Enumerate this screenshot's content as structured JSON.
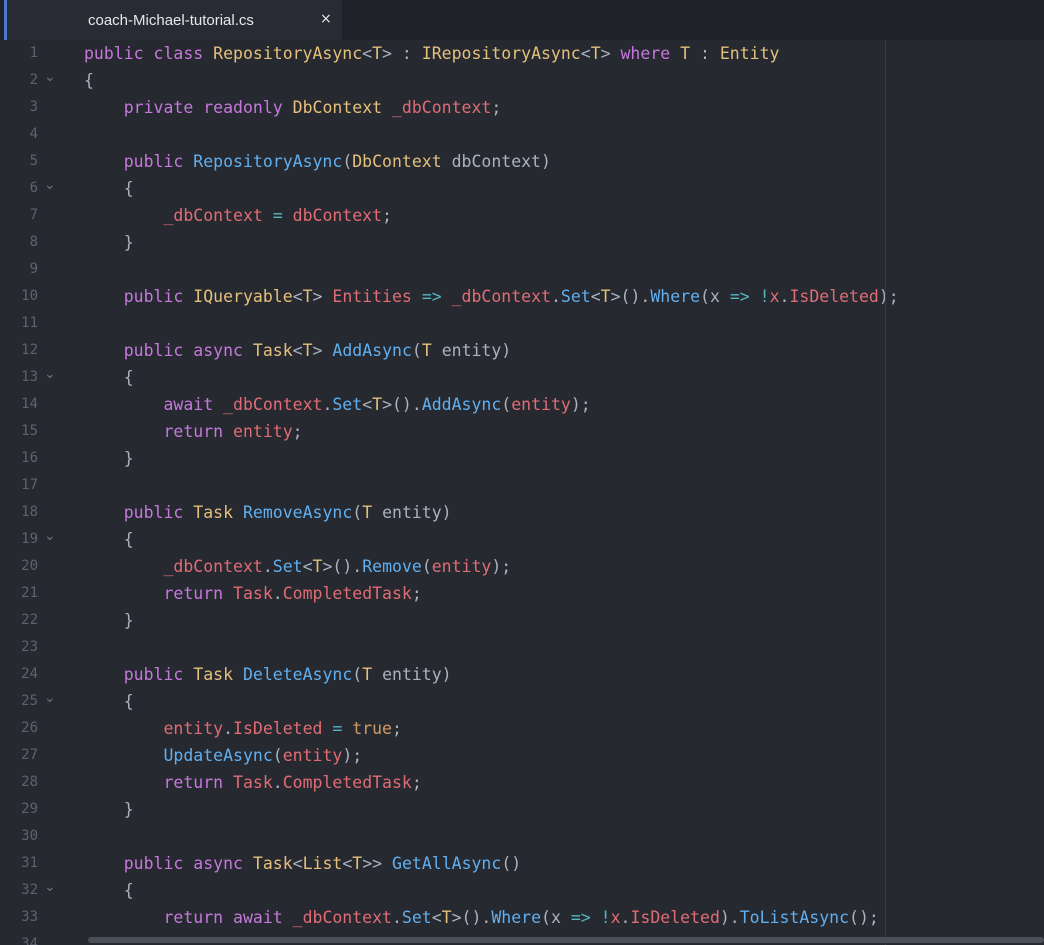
{
  "tab": {
    "title": "coach-Michael-tutorial.cs",
    "close_glyph": "×"
  },
  "icons": {
    "fold": "chevron-down-icon"
  },
  "colors": {
    "background": "#262930",
    "tabbar": "#1e2127",
    "keyword": "#c678dd",
    "type": "#e5c07b",
    "function": "#61afef",
    "field": "#e06c75",
    "operator": "#56b6c2",
    "plain": "#abb2bf",
    "constant": "#d19a66",
    "line_number": "#5c6370"
  },
  "editor": {
    "line_numbers": [
      "1",
      "2",
      "3",
      "4",
      "5",
      "6",
      "7",
      "8",
      "9",
      "10",
      "11",
      "12",
      "13",
      "14",
      "15",
      "16",
      "17",
      "18",
      "19",
      "20",
      "21",
      "22",
      "23",
      "24",
      "25",
      "26",
      "27",
      "28",
      "29",
      "30",
      "31",
      "32",
      "33",
      "34"
    ],
    "fold_markers": [
      2,
      6,
      13,
      19,
      25,
      32
    ],
    "lines": [
      [
        [
          "keyword",
          "public"
        ],
        [
          "plain",
          " "
        ],
        [
          "keyword",
          "class"
        ],
        [
          "plain",
          " "
        ],
        [
          "type",
          "RepositoryAsync"
        ],
        [
          "plain",
          "<"
        ],
        [
          "type",
          "T"
        ],
        [
          "plain",
          "> : "
        ],
        [
          "type",
          "IRepositoryAsync"
        ],
        [
          "plain",
          "<"
        ],
        [
          "type",
          "T"
        ],
        [
          "plain",
          "> "
        ],
        [
          "keyword",
          "where"
        ],
        [
          "plain",
          " "
        ],
        [
          "type",
          "T"
        ],
        [
          "plain",
          " : "
        ],
        [
          "type",
          "Entity"
        ]
      ],
      [
        [
          "plain",
          "{"
        ]
      ],
      [
        [
          "plain",
          "    "
        ],
        [
          "keyword",
          "private"
        ],
        [
          "plain",
          " "
        ],
        [
          "keyword",
          "readonly"
        ],
        [
          "plain",
          " "
        ],
        [
          "type",
          "DbContext"
        ],
        [
          "plain",
          " "
        ],
        [
          "field",
          "_dbContext"
        ],
        [
          "plain",
          ";"
        ]
      ],
      [],
      [
        [
          "plain",
          "    "
        ],
        [
          "keyword",
          "public"
        ],
        [
          "plain",
          " "
        ],
        [
          "func",
          "RepositoryAsync"
        ],
        [
          "plain",
          "("
        ],
        [
          "type",
          "DbContext"
        ],
        [
          "plain",
          " dbContext)"
        ]
      ],
      [
        [
          "plain",
          "    {"
        ]
      ],
      [
        [
          "plain",
          "        "
        ],
        [
          "field",
          "_dbContext"
        ],
        [
          "plain",
          " "
        ],
        [
          "op",
          "="
        ],
        [
          "plain",
          " "
        ],
        [
          "field",
          "dbContext"
        ],
        [
          "plain",
          ";"
        ]
      ],
      [
        [
          "plain",
          "    }"
        ]
      ],
      [],
      [
        [
          "plain",
          "    "
        ],
        [
          "keyword",
          "public"
        ],
        [
          "plain",
          " "
        ],
        [
          "type",
          "IQueryable"
        ],
        [
          "plain",
          "<"
        ],
        [
          "type",
          "T"
        ],
        [
          "plain",
          "> "
        ],
        [
          "field",
          "Entities"
        ],
        [
          "plain",
          " "
        ],
        [
          "op",
          "=>"
        ],
        [
          "plain",
          " "
        ],
        [
          "field",
          "_dbContext"
        ],
        [
          "plain",
          "."
        ],
        [
          "func",
          "Set"
        ],
        [
          "plain",
          "<"
        ],
        [
          "type",
          "T"
        ],
        [
          "plain",
          ">()."
        ],
        [
          "func",
          "Where"
        ],
        [
          "plain",
          "(x "
        ],
        [
          "op",
          "=>"
        ],
        [
          "plain",
          " "
        ],
        [
          "op",
          "!"
        ],
        [
          "field",
          "x"
        ],
        [
          "plain",
          "."
        ],
        [
          "field",
          "IsDeleted"
        ],
        [
          "plain",
          ");"
        ]
      ],
      [],
      [
        [
          "plain",
          "    "
        ],
        [
          "keyword",
          "public"
        ],
        [
          "plain",
          " "
        ],
        [
          "keyword",
          "async"
        ],
        [
          "plain",
          " "
        ],
        [
          "type",
          "Task"
        ],
        [
          "plain",
          "<"
        ],
        [
          "type",
          "T"
        ],
        [
          "plain",
          "> "
        ],
        [
          "func",
          "AddAsync"
        ],
        [
          "plain",
          "("
        ],
        [
          "type",
          "T"
        ],
        [
          "plain",
          " entity)"
        ]
      ],
      [
        [
          "plain",
          "    {"
        ]
      ],
      [
        [
          "plain",
          "        "
        ],
        [
          "keyword",
          "await"
        ],
        [
          "plain",
          " "
        ],
        [
          "field",
          "_dbContext"
        ],
        [
          "plain",
          "."
        ],
        [
          "func",
          "Set"
        ],
        [
          "plain",
          "<"
        ],
        [
          "type",
          "T"
        ],
        [
          "plain",
          ">()."
        ],
        [
          "func",
          "AddAsync"
        ],
        [
          "plain",
          "("
        ],
        [
          "field",
          "entity"
        ],
        [
          "plain",
          ");"
        ]
      ],
      [
        [
          "plain",
          "        "
        ],
        [
          "keyword",
          "return"
        ],
        [
          "plain",
          " "
        ],
        [
          "field",
          "entity"
        ],
        [
          "plain",
          ";"
        ]
      ],
      [
        [
          "plain",
          "    }"
        ]
      ],
      [],
      [
        [
          "plain",
          "    "
        ],
        [
          "keyword",
          "public"
        ],
        [
          "plain",
          " "
        ],
        [
          "type",
          "Task"
        ],
        [
          "plain",
          " "
        ],
        [
          "func",
          "RemoveAsync"
        ],
        [
          "plain",
          "("
        ],
        [
          "type",
          "T"
        ],
        [
          "plain",
          " entity)"
        ]
      ],
      [
        [
          "plain",
          "    {"
        ]
      ],
      [
        [
          "plain",
          "        "
        ],
        [
          "field",
          "_dbContext"
        ],
        [
          "plain",
          "."
        ],
        [
          "func",
          "Set"
        ],
        [
          "plain",
          "<"
        ],
        [
          "type",
          "T"
        ],
        [
          "plain",
          ">()."
        ],
        [
          "func",
          "Remove"
        ],
        [
          "plain",
          "("
        ],
        [
          "field",
          "entity"
        ],
        [
          "plain",
          ");"
        ]
      ],
      [
        [
          "plain",
          "        "
        ],
        [
          "keyword",
          "return"
        ],
        [
          "plain",
          " "
        ],
        [
          "field",
          "Task"
        ],
        [
          "plain",
          "."
        ],
        [
          "field",
          "CompletedTask"
        ],
        [
          "plain",
          ";"
        ]
      ],
      [
        [
          "plain",
          "    }"
        ]
      ],
      [],
      [
        [
          "plain",
          "    "
        ],
        [
          "keyword",
          "public"
        ],
        [
          "plain",
          " "
        ],
        [
          "type",
          "Task"
        ],
        [
          "plain",
          " "
        ],
        [
          "func",
          "DeleteAsync"
        ],
        [
          "plain",
          "("
        ],
        [
          "type",
          "T"
        ],
        [
          "plain",
          " entity)"
        ]
      ],
      [
        [
          "plain",
          "    {"
        ]
      ],
      [
        [
          "plain",
          "        "
        ],
        [
          "field",
          "entity"
        ],
        [
          "plain",
          "."
        ],
        [
          "field",
          "IsDeleted"
        ],
        [
          "plain",
          " "
        ],
        [
          "op",
          "="
        ],
        [
          "plain",
          " "
        ],
        [
          "const",
          "true"
        ],
        [
          "plain",
          ";"
        ]
      ],
      [
        [
          "plain",
          "        "
        ],
        [
          "func",
          "UpdateAsync"
        ],
        [
          "plain",
          "("
        ],
        [
          "field",
          "entity"
        ],
        [
          "plain",
          ");"
        ]
      ],
      [
        [
          "plain",
          "        "
        ],
        [
          "keyword",
          "return"
        ],
        [
          "plain",
          " "
        ],
        [
          "field",
          "Task"
        ],
        [
          "plain",
          "."
        ],
        [
          "field",
          "CompletedTask"
        ],
        [
          "plain",
          ";"
        ]
      ],
      [
        [
          "plain",
          "    }"
        ]
      ],
      [],
      [
        [
          "plain",
          "    "
        ],
        [
          "keyword",
          "public"
        ],
        [
          "plain",
          " "
        ],
        [
          "keyword",
          "async"
        ],
        [
          "plain",
          " "
        ],
        [
          "type",
          "Task"
        ],
        [
          "plain",
          "<"
        ],
        [
          "type",
          "List"
        ],
        [
          "plain",
          "<"
        ],
        [
          "type",
          "T"
        ],
        [
          "plain",
          ">> "
        ],
        [
          "func",
          "GetAllAsync"
        ],
        [
          "plain",
          "()"
        ]
      ],
      [
        [
          "plain",
          "    {"
        ]
      ],
      [
        [
          "plain",
          "        "
        ],
        [
          "keyword",
          "return"
        ],
        [
          "plain",
          " "
        ],
        [
          "keyword",
          "await"
        ],
        [
          "plain",
          " "
        ],
        [
          "field",
          "_dbContext"
        ],
        [
          "plain",
          "."
        ],
        [
          "func",
          "Set"
        ],
        [
          "plain",
          "<"
        ],
        [
          "type",
          "T"
        ],
        [
          "plain",
          ">()."
        ],
        [
          "func",
          "Where"
        ],
        [
          "plain",
          "(x "
        ],
        [
          "op",
          "=>"
        ],
        [
          "plain",
          " "
        ],
        [
          "op",
          "!"
        ],
        [
          "field",
          "x"
        ],
        [
          "plain",
          "."
        ],
        [
          "field",
          "IsDeleted"
        ],
        [
          "plain",
          ")."
        ],
        [
          "func",
          "ToListAsync"
        ],
        [
          "plain",
          "();"
        ]
      ],
      []
    ]
  }
}
